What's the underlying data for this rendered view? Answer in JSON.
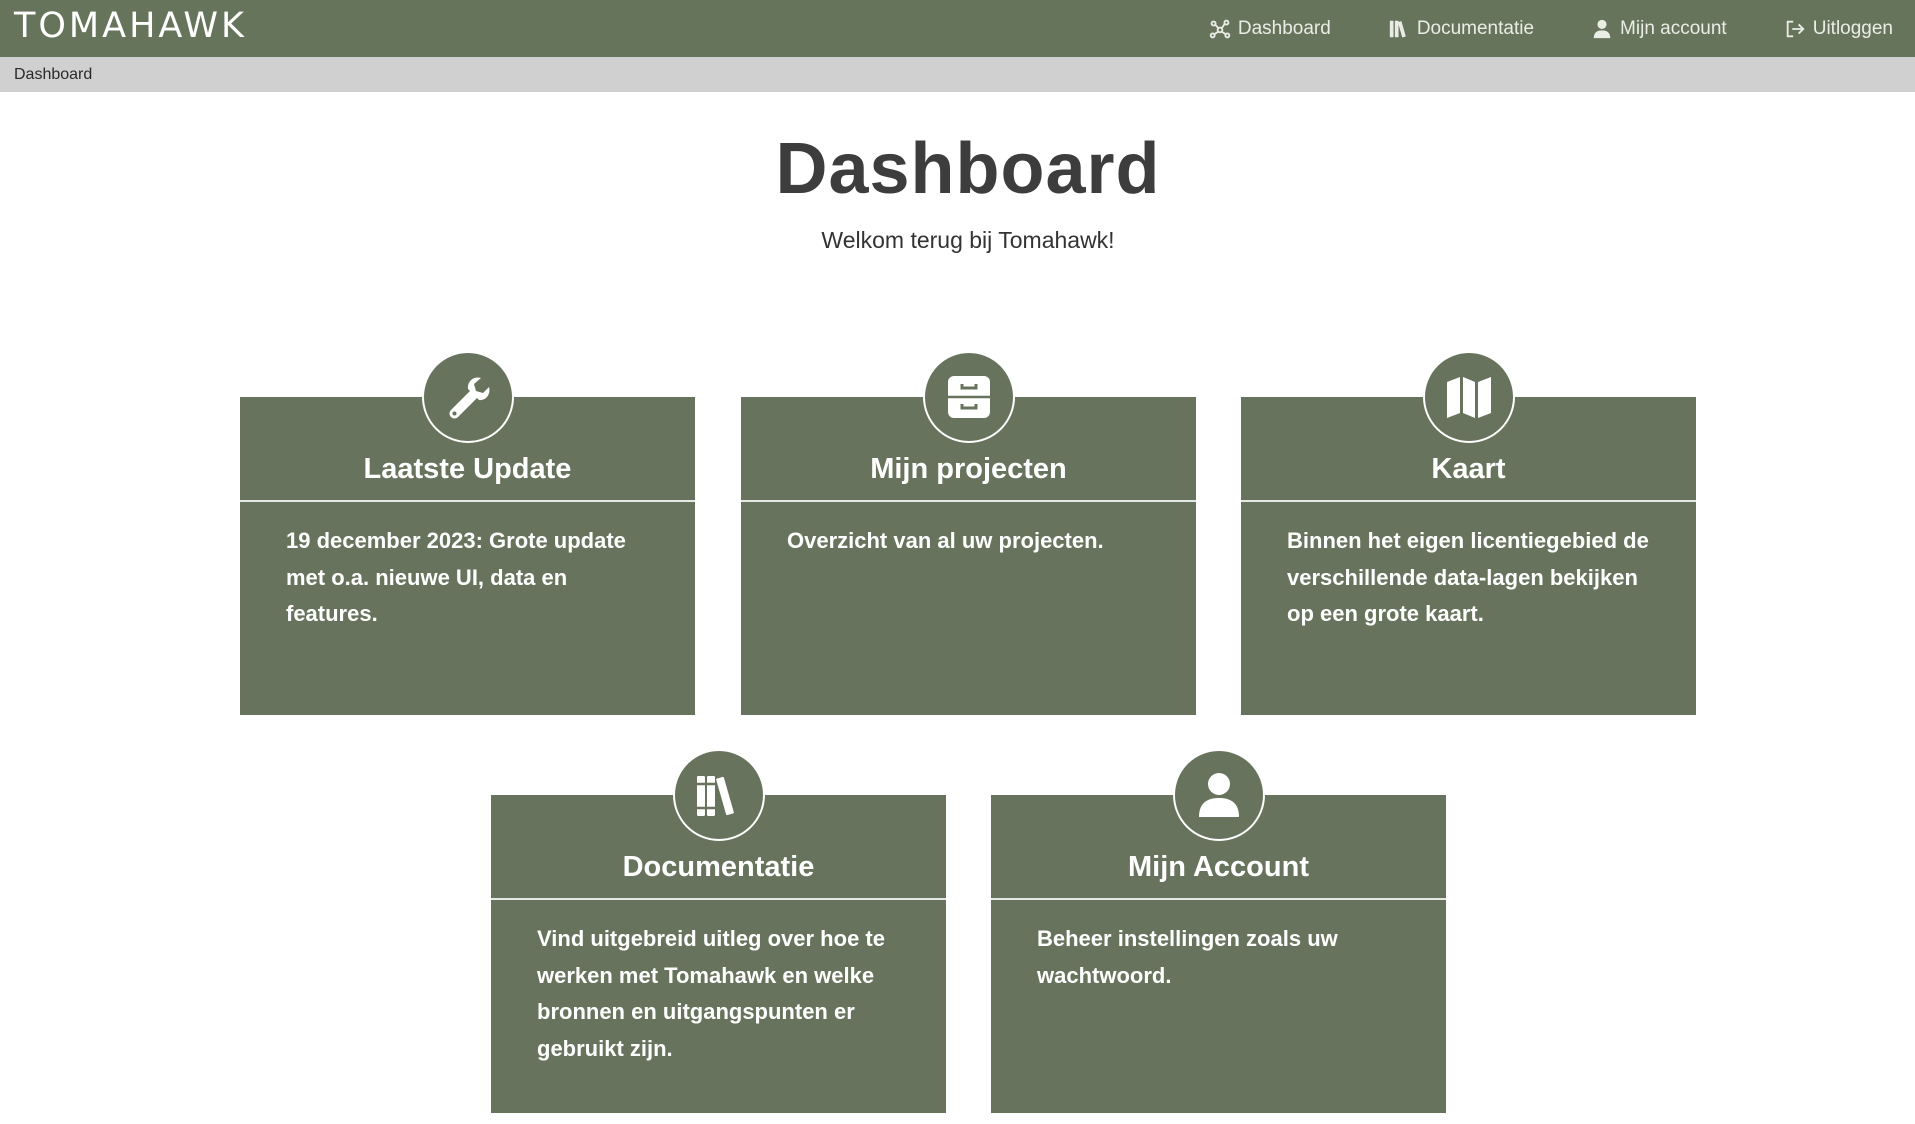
{
  "brand": {
    "logo_text": "TOMAHAWK"
  },
  "nav": {
    "items": [
      {
        "label": "Dashboard",
        "icon": "network-icon"
      },
      {
        "label": "Documentatie",
        "icon": "books-icon"
      },
      {
        "label": "Mijn account",
        "icon": "user-icon"
      },
      {
        "label": "Uitloggen",
        "icon": "logout-icon"
      }
    ]
  },
  "breadcrumb": {
    "current": "Dashboard"
  },
  "page": {
    "title": "Dashboard",
    "subtitle": "Welkom terug bij Tomahawk!"
  },
  "cards": [
    {
      "title": "Laatste Update",
      "icon": "wrench-icon",
      "text": "19 december 2023: Grote update met o.a. nieuwe UI, data en features."
    },
    {
      "title": "Mijn projecten",
      "icon": "archive-icon",
      "text": "Overzicht van al uw projecten."
    },
    {
      "title": "Kaart",
      "icon": "map-icon",
      "text": "Binnen het eigen licentiegebied de verschillende data-lagen bekijken op een grote kaart."
    },
    {
      "title": "Documentatie",
      "icon": "books-icon",
      "text": "Vind uitgebreid uitleg over hoe te werken met Tomahawk en welke bronnen en uitgangspunten er gebruikt zijn."
    },
    {
      "title": "Mijn Account",
      "icon": "user-icon",
      "text": "Beheer instellingen zoals uw wachtwoord."
    }
  ],
  "colors": {
    "primary": "#67745c",
    "breadcrumb_bg": "#d0d0d0",
    "heading": "#3d3d3d"
  }
}
